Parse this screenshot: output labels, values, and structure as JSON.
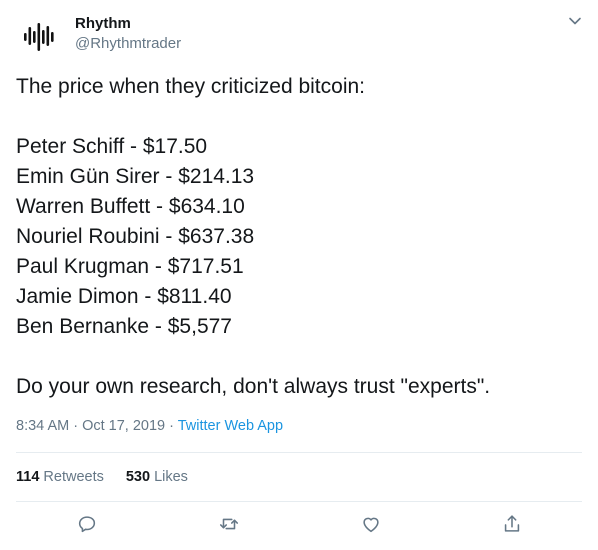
{
  "author": {
    "name": "Rhythm",
    "handle": "@Rhythmtrader",
    "avatar_icon": "soundwave-logo-icon"
  },
  "tweet": {
    "intro": "The price when they criticized bitcoin:",
    "items": [
      "Peter Schiff - $17.50",
      "Emin Gün Sirer - $214.13",
      "Warren Buffett - $634.10",
      "Nouriel Roubini - $637.38",
      "Paul Krugman - $717.51",
      "Jamie Dimon - $811.40",
      "Ben Bernanke - $5,577"
    ],
    "outro": "Do your own research, don't always trust \"experts\"."
  },
  "meta": {
    "time": "8:34 AM",
    "separator": " · ",
    "date": "Oct 17, 2019",
    "separator2": " · ",
    "source": "Twitter Web App"
  },
  "stats": {
    "retweets_count": "114",
    "retweets_label": "Retweets",
    "likes_count": "530",
    "likes_label": "Likes"
  },
  "actions": [
    "reply-icon",
    "retweet-icon",
    "like-icon",
    "share-icon"
  ],
  "colors": {
    "text": "#14171a",
    "secondary": "#657786",
    "link": "#1b95e0",
    "divider": "#e6ecf0"
  }
}
